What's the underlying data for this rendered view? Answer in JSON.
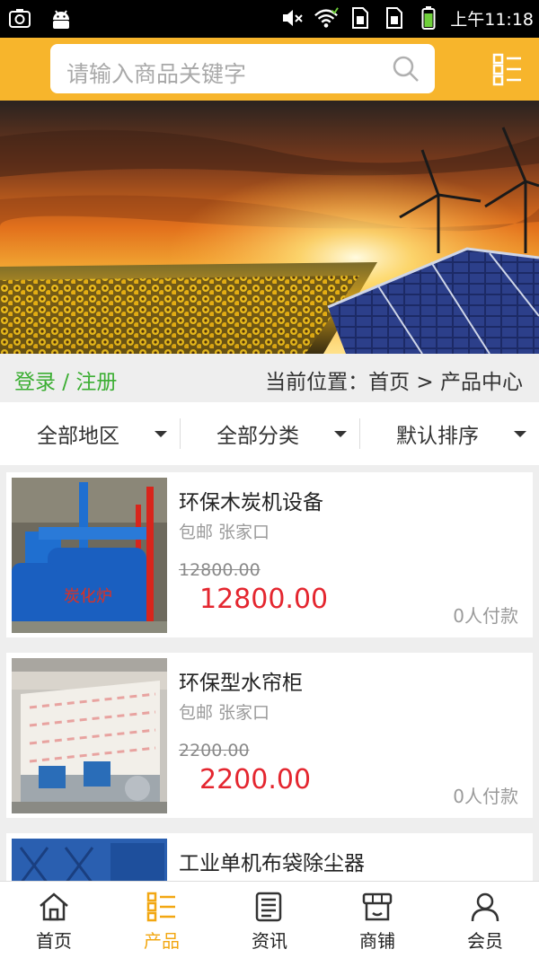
{
  "status_bar": {
    "time": "上午11:18",
    "icons": [
      "screenshot-icon",
      "android-icon",
      "mute-icon",
      "wifi-icon",
      "sim1-icon",
      "sim2-icon",
      "battery-icon"
    ]
  },
  "header": {
    "search_placeholder": "请输入商品关键字",
    "accent_color": "#f7b52c"
  },
  "banner": {
    "icons": [
      "wind-turbine-icon",
      "solar-panel-icon",
      "sunflower-field"
    ]
  },
  "crumb_bar": {
    "login_label": "登录 / 注册",
    "breadcrumb": "当前位置：首页 > 产品中心"
  },
  "filters": [
    {
      "label": "全部地区"
    },
    {
      "label": "全部分类"
    },
    {
      "label": "默认排序"
    }
  ],
  "products": [
    {
      "name": "环保木炭机设备",
      "meta": "包邮 张家口",
      "old_price": "12800.00",
      "price": "12800.00",
      "buyers": "0人付款"
    },
    {
      "name": "环保型水帘柜",
      "meta": "包邮 张家口",
      "old_price": "2200.00",
      "price": "2200.00",
      "buyers": "0人付款"
    },
    {
      "name": "工业单机布袋除尘器",
      "meta": "",
      "old_price": "",
      "price": "",
      "buyers": ""
    }
  ],
  "tabs": [
    {
      "label": "首页",
      "icon": "home-icon",
      "active": false
    },
    {
      "label": "产品",
      "icon": "product-list-icon",
      "active": true
    },
    {
      "label": "资讯",
      "icon": "news-icon",
      "active": false
    },
    {
      "label": "商铺",
      "icon": "shop-icon",
      "active": false
    },
    {
      "label": "会员",
      "icon": "member-icon",
      "active": false
    }
  ],
  "colors": {
    "price": "#e4262f",
    "login": "#3cae33",
    "active_tab": "#f2a712"
  }
}
